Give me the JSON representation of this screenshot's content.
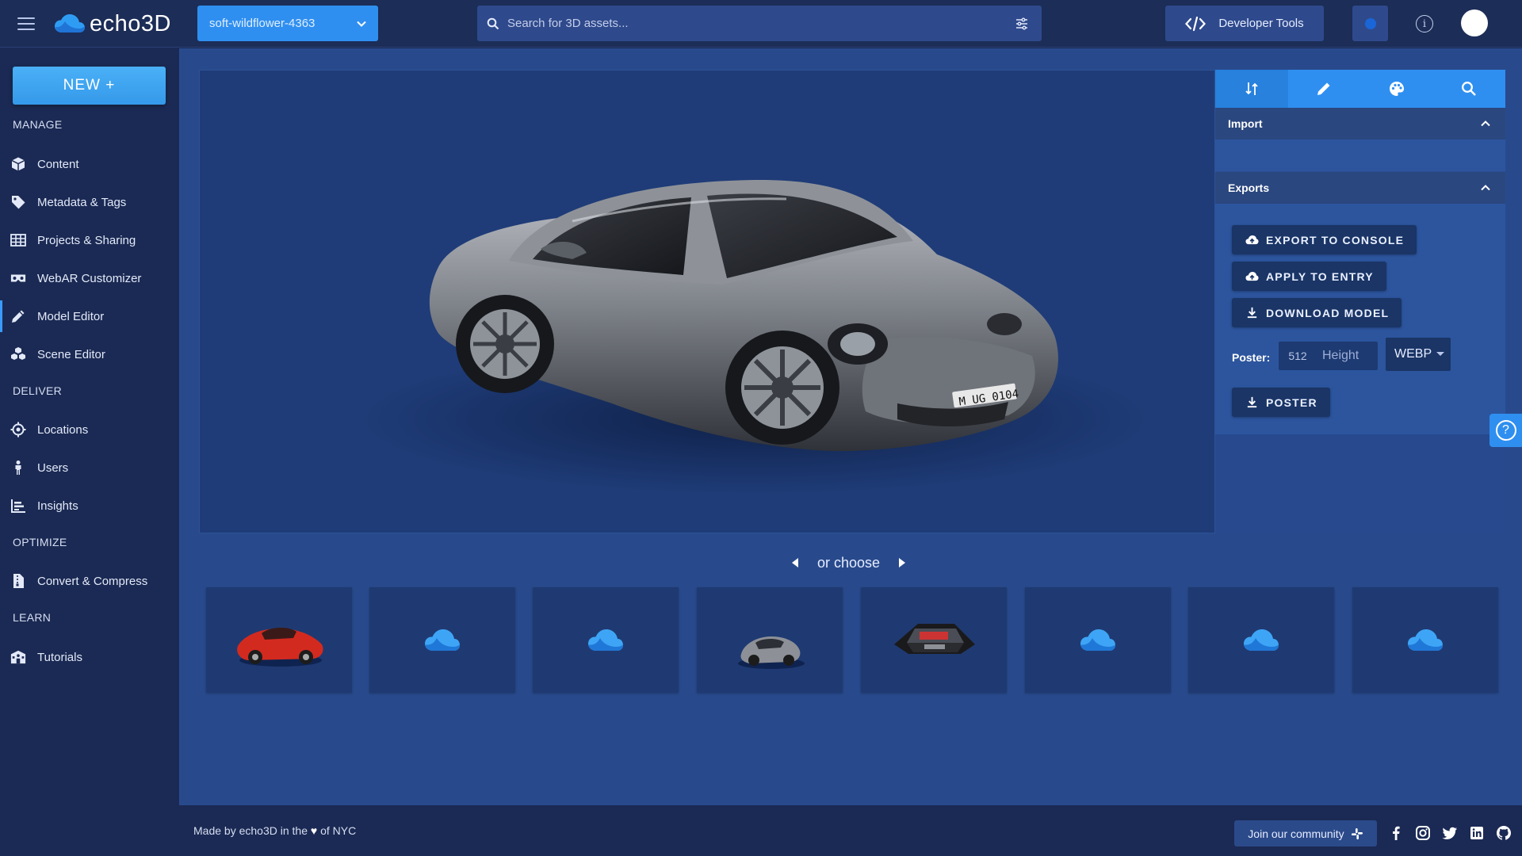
{
  "brand": {
    "name": "echo3D",
    "accent": "#2f8ff0"
  },
  "header": {
    "project": "soft-wildflower-4363",
    "search_placeholder": "Search for 3D assets...",
    "devtools_label": "Developer Tools",
    "info_symbol": "i"
  },
  "sidebar": {
    "new_label": "NEW +",
    "sections": {
      "manage": "MANAGE",
      "deliver": "DELIVER",
      "optimize": "OPTIMIZE",
      "learn": "LEARN"
    },
    "items": {
      "content": "Content",
      "metadata": "Metadata & Tags",
      "projects": "Projects & Sharing",
      "webar": "WebAR Customizer",
      "model_editor": "Model Editor",
      "scene_editor": "Scene Editor",
      "locations": "Locations",
      "users": "Users",
      "insights": "Insights",
      "convert": "Convert & Compress",
      "tutorials": "Tutorials"
    },
    "active": "model_editor"
  },
  "viewer": {
    "plate": "M UG 0104"
  },
  "panel": {
    "tabs": [
      "transform-icon",
      "pencil-icon",
      "palette-icon",
      "search-icon"
    ],
    "import_title": "Import",
    "exports_title": "Exports",
    "export_console": "EXPORT TO CONSOLE",
    "apply_entry": "APPLY TO ENTRY",
    "download_model": "DOWNLOAD MODEL",
    "poster_label": "Poster:",
    "poster_width": "512",
    "poster_height_placeholder": "Height",
    "poster_format": "WEBP",
    "poster_button": "POSTER"
  },
  "chooser": {
    "label": "or choose",
    "thumbnails": [
      "red-sports-car",
      "cloud-placeholder",
      "cloud-placeholder",
      "silver-sports-car",
      "car-engine-bay",
      "cloud-placeholder",
      "cloud-placeholder",
      "cloud-placeholder"
    ]
  },
  "footer": {
    "made_prefix": "Made by echo3D in the",
    "heart": "♥",
    "made_suffix": "of NYC",
    "community": "Join our community",
    "socials": [
      "facebook-icon",
      "instagram-icon",
      "twitter-icon",
      "linkedin-icon",
      "github-icon"
    ]
  }
}
